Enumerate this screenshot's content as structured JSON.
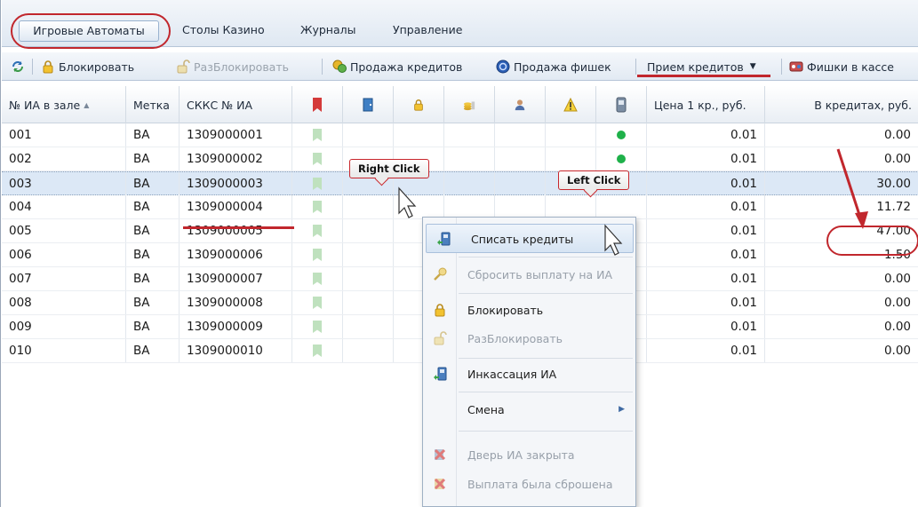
{
  "tabs": [
    {
      "label": "Игровые Автоматы",
      "active": true
    },
    {
      "label": "Столы Казино",
      "active": false
    },
    {
      "label": "Журналы",
      "active": false
    },
    {
      "label": "Управление",
      "active": false
    }
  ],
  "toolbar": {
    "refresh_icon": "refresh-icon",
    "block_label": "Блокировать",
    "unblock_label": "РазБлокировать",
    "sell_credits_label": "Продажа кредитов",
    "sell_chips_label": "Продажа фишек",
    "accept_credits_label": "Прием кредитов",
    "chips_at_cashier_label": "Фишки в кассе"
  },
  "table": {
    "headers": {
      "num": "№ ИА в зале",
      "tag": "Метка",
      "skkc": "СККС № ИА",
      "price": "Цена 1 кр., руб.",
      "credits": "В кредитах, руб."
    },
    "rows": [
      {
        "num": "001",
        "tag": "BA",
        "skkc": "1309000001",
        "status": "green",
        "price": "0.01",
        "credits": "0.00"
      },
      {
        "num": "002",
        "tag": "BA",
        "skkc": "1309000002",
        "status": "green",
        "price": "0.01",
        "credits": "0.00"
      },
      {
        "num": "003",
        "tag": "BA",
        "skkc": "1309000003",
        "status": "",
        "price": "0.01",
        "credits": "30.00"
      },
      {
        "num": "004",
        "tag": "BA",
        "skkc": "1309000004",
        "status": "",
        "price": "0.01",
        "credits": "11.72"
      },
      {
        "num": "005",
        "tag": "BA",
        "skkc": "1309000005",
        "status": "",
        "price": "0.01",
        "credits": "47.00"
      },
      {
        "num": "006",
        "tag": "BA",
        "skkc": "1309000006",
        "status": "",
        "price": "0.01",
        "credits": "1.50"
      },
      {
        "num": "007",
        "tag": "BA",
        "skkc": "1309000007",
        "status": "",
        "price": "0.01",
        "credits": "0.00"
      },
      {
        "num": "008",
        "tag": "BA",
        "skkc": "1309000008",
        "status": "",
        "price": "0.01",
        "credits": "0.00"
      },
      {
        "num": "009",
        "tag": "BA",
        "skkc": "1309000009",
        "status": "",
        "price": "0.01",
        "credits": "0.00"
      },
      {
        "num": "010",
        "tag": "BA",
        "skkc": "1309000010",
        "status": "",
        "price": "0.01",
        "credits": "0.00"
      }
    ]
  },
  "context_menu": {
    "items": [
      {
        "label": "Списать кредиты",
        "disabled": false,
        "icon": "write-off-icon"
      },
      {
        "label": "Сбросить выплату на ИА",
        "disabled": true,
        "icon": "key-icon"
      },
      {
        "label": "Блокировать",
        "disabled": false,
        "icon": "lock-icon"
      },
      {
        "label": "РазБлокировать",
        "disabled": true,
        "icon": "unlock-icon"
      },
      {
        "label": "Инкассация ИА",
        "disabled": false,
        "icon": "collection-icon"
      },
      {
        "label": "Смена",
        "disabled": false,
        "icon": ""
      },
      {
        "label": "Дверь ИА закрыта",
        "disabled": true,
        "icon": "door-closed-icon"
      },
      {
        "label": "Выплата была сброшена",
        "disabled": true,
        "icon": "payout-reset-icon"
      }
    ]
  },
  "annotations": {
    "right_click": "Right Click",
    "left_click": "Left Click"
  },
  "colors": {
    "annotation_red": "#c1272d",
    "status_green": "#1fb14a",
    "selected_row": "#dce8f6"
  }
}
